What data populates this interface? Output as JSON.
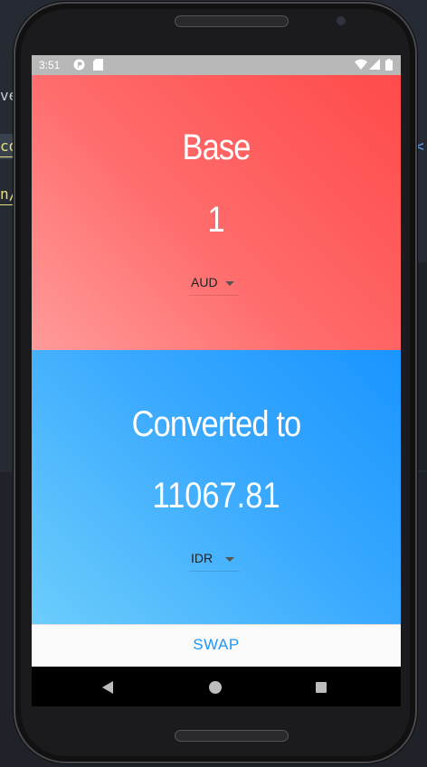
{
  "ide": {
    "line1": "ve",
    "line2": "co",
    "line3": "n/",
    "line4": "<"
  },
  "statusbar": {
    "time": "3:51",
    "icons": [
      "app-p-icon",
      "sd-card-icon",
      "wifi-icon",
      "signal-icon",
      "battery-icon"
    ]
  },
  "base": {
    "title": "Base",
    "value": "1",
    "currency": "AUD"
  },
  "converted": {
    "title": "Converted to",
    "value": "11067.81",
    "currency": "IDR"
  },
  "swap": {
    "label": "SWAP"
  },
  "colors": {
    "base_gradient": [
      "#ff9a9a",
      "#ff4a4a"
    ],
    "converted_gradient": [
      "#6ccdfb",
      "#1a95ff"
    ],
    "accent": "#2196f3"
  },
  "navbar": {
    "icons": [
      "back-icon",
      "home-icon",
      "recents-icon"
    ]
  }
}
